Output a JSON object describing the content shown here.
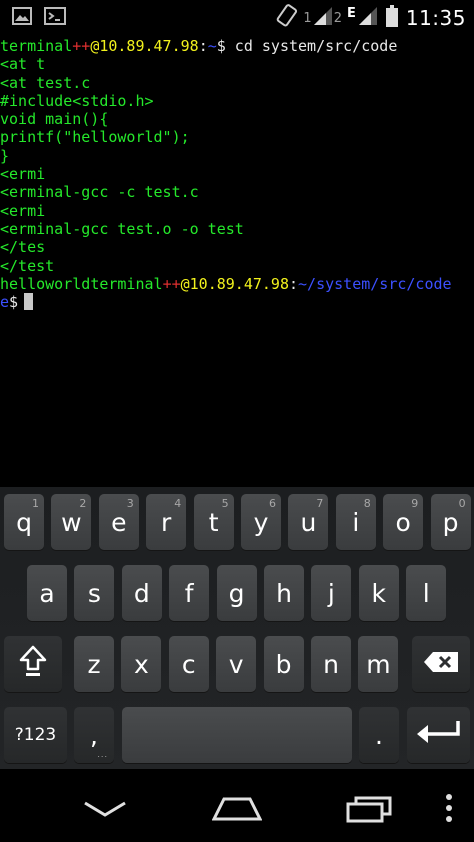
{
  "status_bar": {
    "sim1_label": "1",
    "sim2_label": "2",
    "network_label": "E",
    "time": "11:35",
    "icons": [
      "image-icon",
      "terminal-app-icon",
      "rotate-phone-icon",
      "signal-icon",
      "signal-icon",
      "battery-icon"
    ]
  },
  "terminal": {
    "lines": [
      [
        {
          "t": "terminal",
          "c": "green"
        },
        {
          "t": "++",
          "c": "red"
        },
        {
          "t": "@10.89.47.98",
          "c": "yellow"
        },
        {
          "t": ":",
          "c": "white"
        },
        {
          "t": "~",
          "c": "blue"
        },
        {
          "t": "$ cd system/src/code",
          "c": "white"
        }
      ],
      [
        {
          "t": "<at t",
          "c": "green"
        }
      ],
      [
        {
          "t": "<at test.c",
          "c": "green"
        }
      ],
      [
        {
          "t": "#include<stdio.h>",
          "c": "green"
        }
      ],
      [
        {
          "t": "void main(){",
          "c": "green"
        }
      ],
      [
        {
          "t": "printf(\"helloworld\");",
          "c": "green"
        }
      ],
      [
        {
          "t": "}",
          "c": "green"
        }
      ],
      [
        {
          "t": "<ermi",
          "c": "green"
        }
      ],
      [
        {
          "t": "<erminal-gcc -c test.c",
          "c": "green"
        }
      ],
      [
        {
          "t": "<ermi",
          "c": "green"
        }
      ],
      [
        {
          "t": "<erminal-gcc test.o -o test",
          "c": "green"
        }
      ],
      [
        {
          "t": "</tes",
          "c": "green"
        }
      ],
      [
        {
          "t": "</test",
          "c": "green"
        }
      ],
      [
        {
          "t": "helloworld",
          "c": "green"
        },
        {
          "t": "terminal",
          "c": "green"
        },
        {
          "t": "++",
          "c": "red"
        },
        {
          "t": "@10.89.47.98",
          "c": "yellow"
        },
        {
          "t": ":",
          "c": "white"
        },
        {
          "t": "~/system/src/code",
          "c": "blue"
        }
      ],
      [
        {
          "t": "e",
          "c": "blue"
        },
        {
          "t": "$",
          "c": "white"
        }
      ]
    ]
  },
  "keyboard": {
    "row1": [
      {
        "label": "q",
        "hint": "1"
      },
      {
        "label": "w",
        "hint": "2"
      },
      {
        "label": "e",
        "hint": "3"
      },
      {
        "label": "r",
        "hint": "4"
      },
      {
        "label": "t",
        "hint": "5"
      },
      {
        "label": "y",
        "hint": "6"
      },
      {
        "label": "u",
        "hint": "7"
      },
      {
        "label": "i",
        "hint": "8"
      },
      {
        "label": "o",
        "hint": "9"
      },
      {
        "label": "p",
        "hint": "0"
      }
    ],
    "row2": [
      "a",
      "s",
      "d",
      "f",
      "g",
      "h",
      "j",
      "k",
      "l"
    ],
    "row3": [
      "z",
      "x",
      "c",
      "v",
      "b",
      "n",
      "m"
    ],
    "symbols_label": "?123",
    "comma_label": ",",
    "period_label": ".",
    "shift_icon": "shift-icon",
    "backspace_icon": "backspace-icon",
    "enter_icon": "enter-icon",
    "more_hint": "..."
  },
  "nav_bar": {
    "icons": [
      "back-chevron-icon",
      "home-icon",
      "recent-apps-icon",
      "menu-dots-icon"
    ]
  }
}
